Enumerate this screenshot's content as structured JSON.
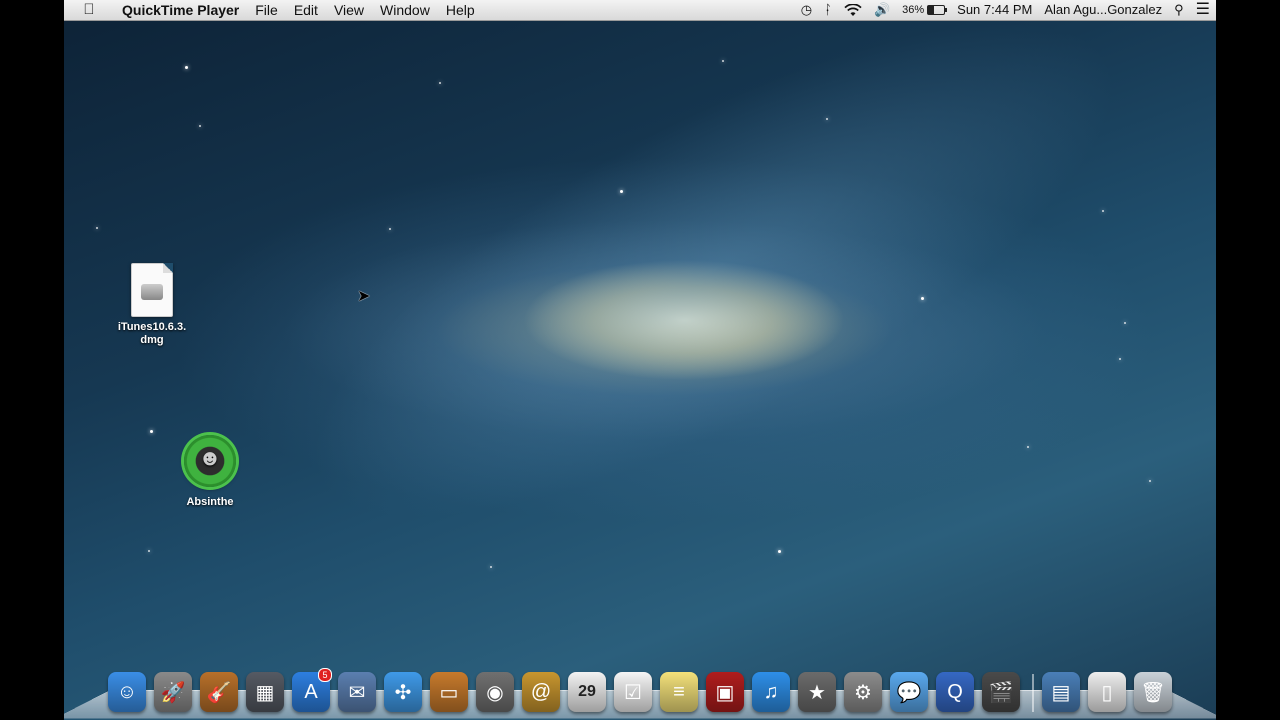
{
  "menubar": {
    "app_name": "QuickTime Player",
    "menus": [
      "File",
      "Edit",
      "View",
      "Window",
      "Help"
    ],
    "status": {
      "battery_percent": "36%",
      "battery_level": 0.36,
      "clock": "Sun 7:44 PM",
      "user": "Alan Agu...Gonzalez"
    }
  },
  "desktop": {
    "icons": [
      {
        "label": "iTunes10.6.3.\ndmg",
        "label_line1": "iTunes10.6.3.",
        "label_line2": "dmg",
        "icon": "dmg-file-icon"
      },
      {
        "label": "Absinthe",
        "icon": "absinthe-icon"
      }
    ]
  },
  "dock": {
    "items": [
      {
        "name": "finder",
        "icon": "finder-icon",
        "color": "#3a8ee6"
      },
      {
        "name": "launchpad",
        "icon": "rocket-icon",
        "color": "#8a8a8a"
      },
      {
        "name": "garageband",
        "icon": "guitar-icon",
        "color": "#b8702a"
      },
      {
        "name": "dashboard",
        "icon": "dashboard-icon",
        "color": "#555a63"
      },
      {
        "name": "app-store",
        "icon": "app-store-icon",
        "color": "#2d7fe0",
        "badge": "5"
      },
      {
        "name": "mail-stamp",
        "icon": "eagle-stamp-icon",
        "color": "#5b7fb0"
      },
      {
        "name": "safari",
        "icon": "compass-icon",
        "color": "#3f9ae8"
      },
      {
        "name": "keynote",
        "icon": "podium-icon",
        "color": "#c77a2c"
      },
      {
        "name": "facetime",
        "icon": "camera-icon",
        "color": "#707070"
      },
      {
        "name": "address-book",
        "icon": "address-book-icon",
        "color": "#c8962f"
      },
      {
        "name": "calendar",
        "icon": "calendar-icon",
        "color": "#f2f2f2",
        "text": "29"
      },
      {
        "name": "reminders",
        "icon": "checklist-icon",
        "color": "#f5f5f5"
      },
      {
        "name": "notes",
        "icon": "notes-icon",
        "color": "#f3e17a"
      },
      {
        "name": "photo-booth",
        "icon": "photo-booth-icon",
        "color": "#b01d1d"
      },
      {
        "name": "itunes",
        "icon": "music-note-icon",
        "color": "#2e8fe8"
      },
      {
        "name": "imovie",
        "icon": "star-icon",
        "color": "#6b6b6b"
      },
      {
        "name": "system-preferences",
        "icon": "gear-icon",
        "color": "#8c8c8c"
      },
      {
        "name": "messages",
        "icon": "speech-bubbles-icon",
        "color": "#5aa9ee"
      },
      {
        "name": "quicktime",
        "icon": "quicktime-icon",
        "color": "#3568c4"
      },
      {
        "name": "final-cut",
        "icon": "clapper-icon",
        "color": "#4a4a4a"
      }
    ],
    "right_items": [
      {
        "name": "applications-folder",
        "icon": "folder-icon",
        "color": "#4a7fb8"
      },
      {
        "name": "documents-stack",
        "icon": "document-icon",
        "color": "#eeeeee"
      },
      {
        "name": "trash",
        "icon": "trash-icon",
        "color": "#c9d1d8"
      }
    ]
  }
}
